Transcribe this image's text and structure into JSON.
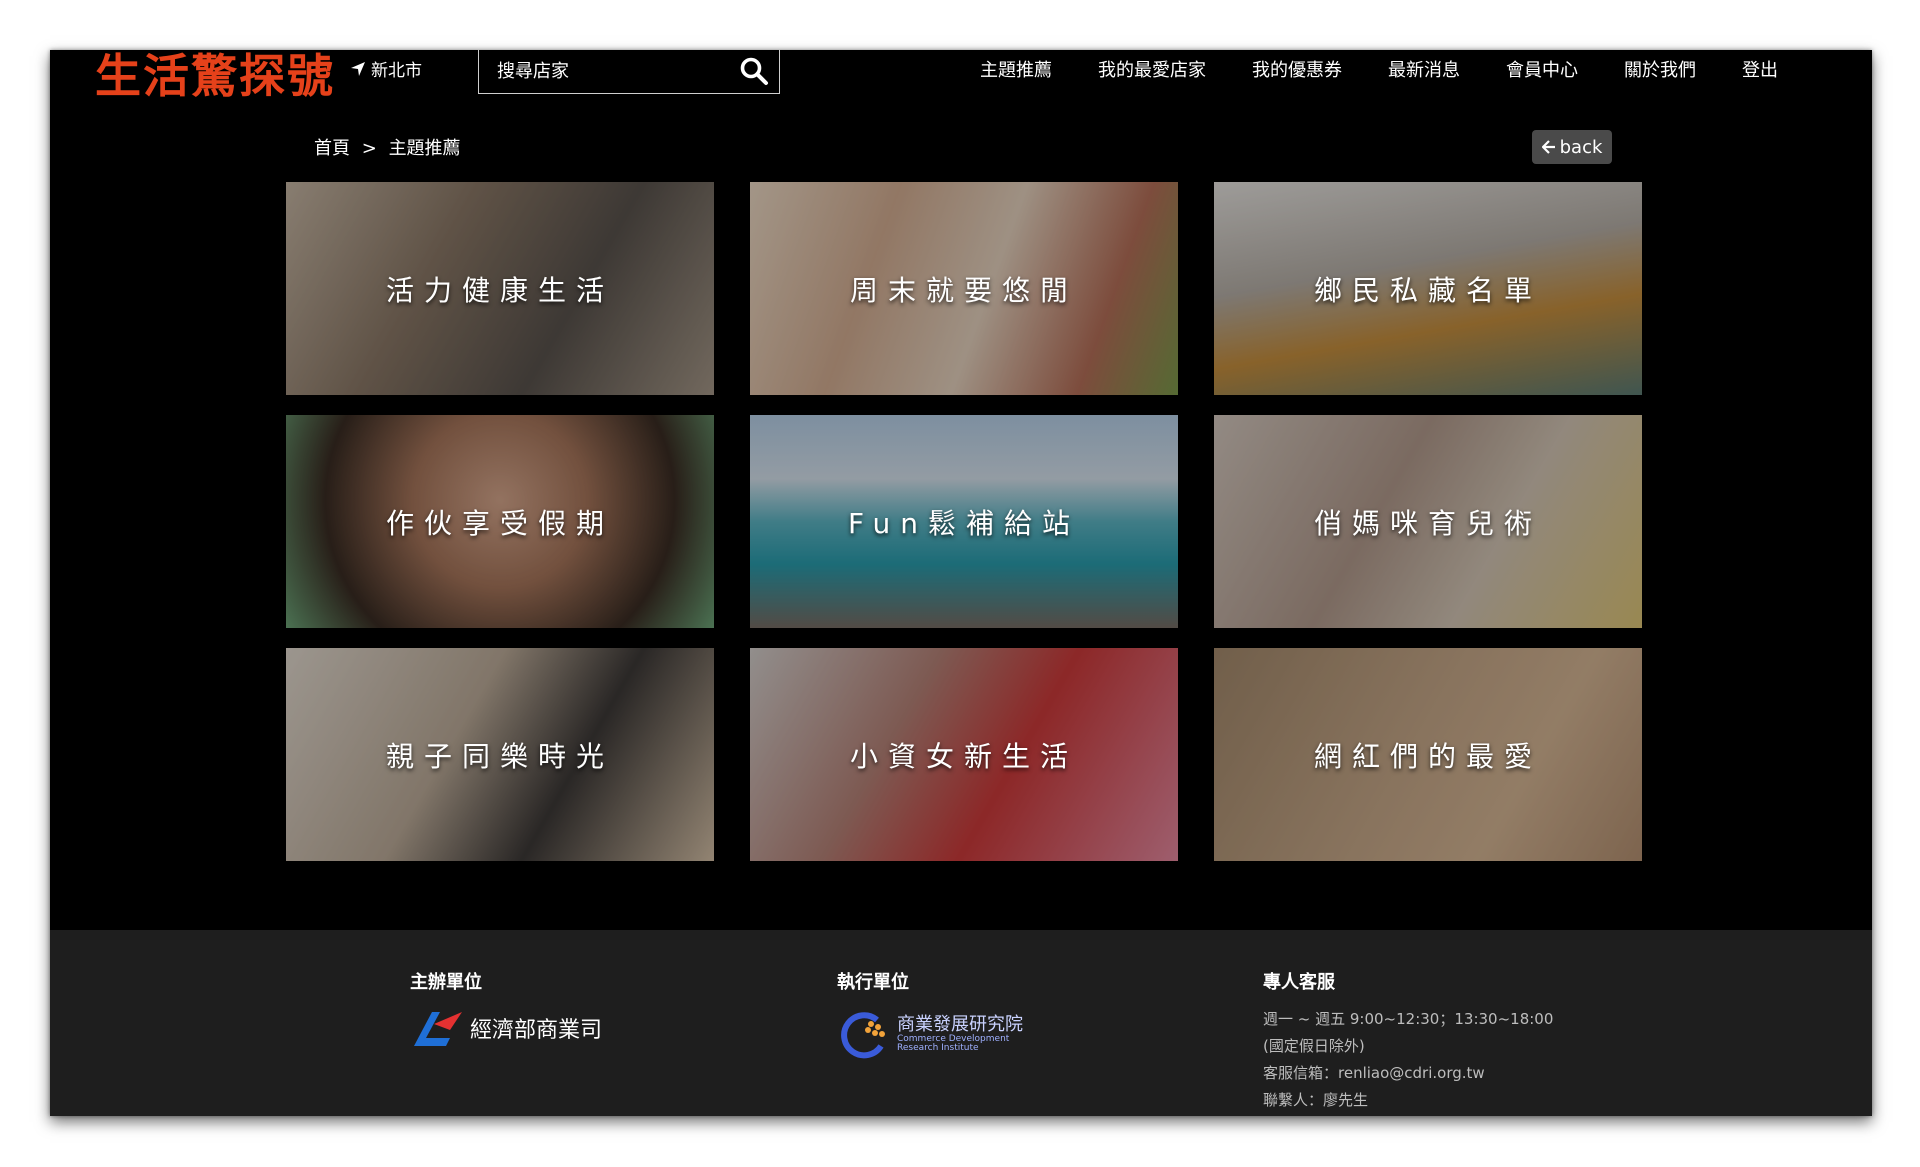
{
  "header": {
    "logo_text": "生活驚探號",
    "location": "新北市",
    "search_placeholder": "搜尋店家",
    "nav": [
      "主題推薦",
      "我的最愛店家",
      "我的優惠券",
      "最新消息",
      "會員中心",
      "關於我們",
      "登出"
    ]
  },
  "breadcrumb": {
    "home": "首頁",
    "separator": ">",
    "current": "主題推薦"
  },
  "back_label": "back",
  "cards": [
    {
      "title": "活力健康生活"
    },
    {
      "title": "周末就要悠閒"
    },
    {
      "title": "鄉民私藏名單"
    },
    {
      "title": "作伙享受假期"
    },
    {
      "title": "Fun鬆補給站"
    },
    {
      "title": "俏媽咪育兒術"
    },
    {
      "title": "親子同樂時光"
    },
    {
      "title": "小資女新生活"
    },
    {
      "title": "網紅們的最愛"
    }
  ],
  "footer": {
    "organizer_title": "主辦單位",
    "organizer_name": "經濟部商業司",
    "executor_title": "執行單位",
    "executor_name_zh": "商業發展研究院",
    "executor_name_en_1": "Commerce Development",
    "executor_name_en_2": "Research Institute",
    "service_title": "專人客服",
    "service_hours": "週一 ~ 週五 9:00~12:30；13:30~18:00",
    "service_holiday": "(國定假日除外)",
    "service_email": "客服信箱：renliao@cdri.org.tw",
    "service_contact": "聯繫人：廖先生"
  },
  "colors": {
    "logo": "#e5411a",
    "page_bg": "#000000",
    "footer_bg": "#1e1e1e",
    "back_button": "#4a4a4a"
  }
}
